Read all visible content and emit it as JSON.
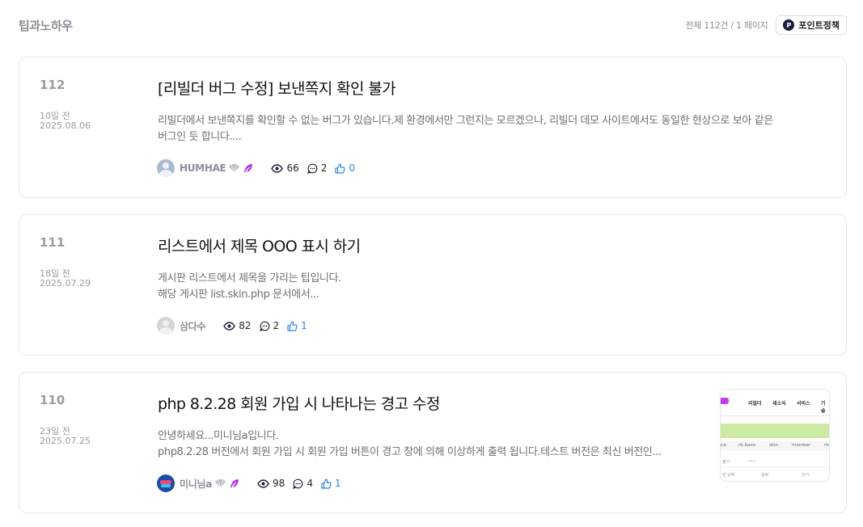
{
  "header": {
    "title": "팁과노하우",
    "counts": "전체 112건 / 1 페이지",
    "point_button": "포인트정책",
    "point_icon_letter": "P"
  },
  "posts": [
    {
      "num": "112",
      "date_relative": "10일 전",
      "date": "2025.08.06",
      "title": "[리빌더 버그 수정] 보낸쪽지 확인 불가",
      "excerpt_lines": [
        "리빌더에서 보낸쪽지를 확인할 수 없는 버그가 있습니다.제 환경에서만 그런지는 모르겠으나, 리빌더 데모 사이트에서도 동일한 현상으로 보아 같은",
        "버그인 듯 합니다...."
      ],
      "author": "HUMHAE",
      "views": "66",
      "comments": "2",
      "likes": "0"
    },
    {
      "num": "111",
      "date_relative": "18일 전",
      "date": "2025.07.29",
      "title": "리스트에서 제목 OOO 표시 하기",
      "excerpt_lines": [
        "게시판 리스트에서 제목을 가리는 팁입니다.",
        "해당 게시판 list.skin.php 문서에서..."
      ],
      "author": "삼다수",
      "views": "82",
      "comments": "2",
      "likes": "1"
    },
    {
      "num": "110",
      "date_relative": "23일 전",
      "date": "2025.07.25",
      "title": "php 8.2.28 회원 가입 시 나타나는 경고 수정",
      "excerpt_lines": [
        "안녕하세요...미니님a입니다.",
        "php8.2.28 버전에서 회원 가입 시 회원 가입 버튼이 경고 창에 의해 이상하게 출력 됩니다.테스트 버전은 최신 버전인..."
      ],
      "author": "미니님a",
      "views": "98",
      "comments": "4",
      "likes": "1",
      "thumbnail": {
        "nav": [
          "리빌더",
          "새소식",
          "서비스",
          "기술"
        ],
        "breadcrumb": [
          "ne",
          "rb.basic",
          "skin",
          "member",
          "rb"
        ],
        "row1": [
          "불가",
          "•••"
        ],
        "row2": [
          "린 날짜",
          "용량",
          "크기"
        ]
      }
    }
  ],
  "colors": {
    "accent_like": "#2f86e8",
    "muted_text": "#8a8f98",
    "badge_purple": "#b233e6"
  },
  "icons": [
    "diamond-badge-icon",
    "quill-badge-icon",
    "eye-icon",
    "comment-icon",
    "thumbs-up-icon"
  ]
}
